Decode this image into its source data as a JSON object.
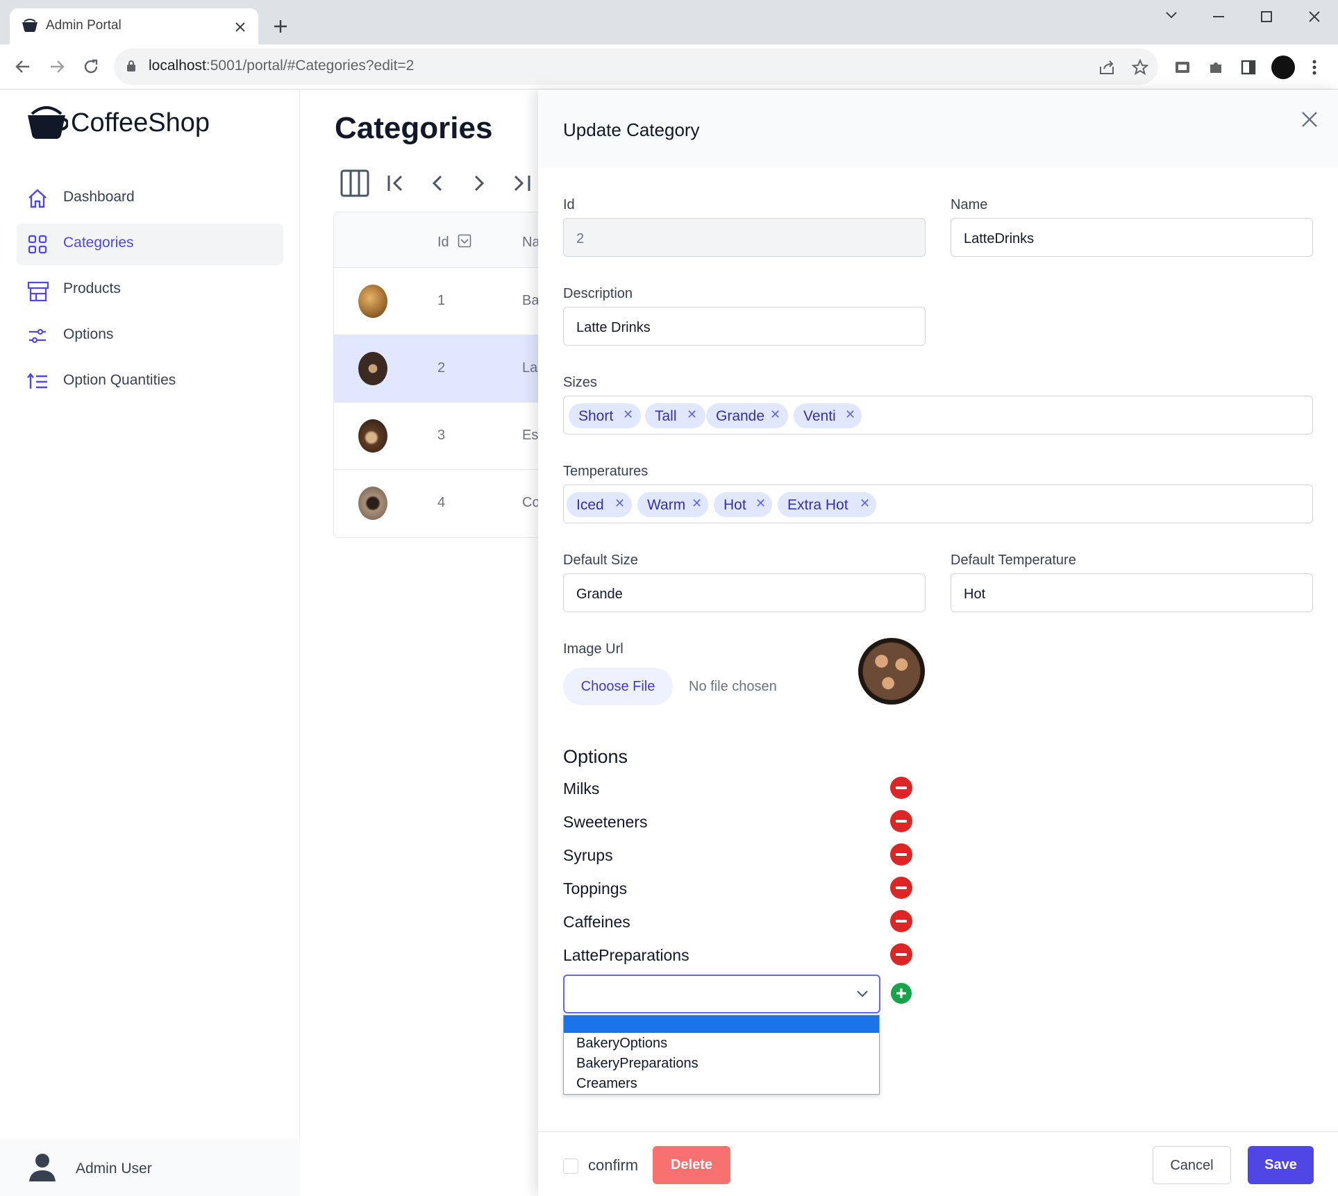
{
  "browser": {
    "tab_title": "Admin Portal",
    "url_host": "localhost",
    "url_rest": ":5001/portal/#Categories?edit=2"
  },
  "sidebar": {
    "brand": "CoffeeShop",
    "items": [
      {
        "label": "Dashboard",
        "icon": "home-icon"
      },
      {
        "label": "Categories",
        "icon": "grid-icon"
      },
      {
        "label": "Products",
        "icon": "store-icon"
      },
      {
        "label": "Options",
        "icon": "sliders-icon"
      },
      {
        "label": "Option Quantities",
        "icon": "sort-list-icon"
      }
    ],
    "user": "Admin User"
  },
  "main": {
    "title": "Categories",
    "columns": [
      "Id",
      "Na"
    ],
    "rows": [
      {
        "id": "1",
        "name": "Ba"
      },
      {
        "id": "2",
        "name": "La"
      },
      {
        "id": "3",
        "name": "Esp"
      },
      {
        "id": "4",
        "name": "Co"
      }
    ]
  },
  "dialog": {
    "title": "Update Category",
    "id_label": "Id",
    "id_value": "2",
    "name_label": "Name",
    "name_value": "LatteDrinks",
    "description_label": "Description",
    "description_value": "Latte Drinks",
    "sizes_label": "Sizes",
    "sizes": [
      "Short",
      "Tall",
      "Grande",
      "Venti"
    ],
    "temperatures_label": "Temperatures",
    "temperatures": [
      "Iced",
      "Warm",
      "Hot",
      "Extra Hot"
    ],
    "default_size_label": "Default Size",
    "default_size_value": "Grande",
    "default_temp_label": "Default Temperature",
    "default_temp_value": "Hot",
    "image_label": "Image Url",
    "choose_file": "Choose File",
    "no_file": "No file chosen",
    "options_heading": "Options",
    "options": [
      "Milks",
      "Sweeteners",
      "Syrups",
      "Toppings",
      "Caffeines",
      "LattePreparations"
    ],
    "dropdown_options": [
      "",
      "BakeryOptions",
      "BakeryPreparations",
      "Creamers"
    ],
    "confirm_label": "confirm",
    "delete_label": "Delete",
    "cancel_label": "Cancel",
    "save_label": "Save"
  },
  "colors": {
    "accent": "#4f46e5",
    "selected_row": "#e0e7ff",
    "tag_bg": "#e0e7ff",
    "remove": "#dc2626",
    "add": "#16a34a",
    "delete": "#f87171"
  }
}
